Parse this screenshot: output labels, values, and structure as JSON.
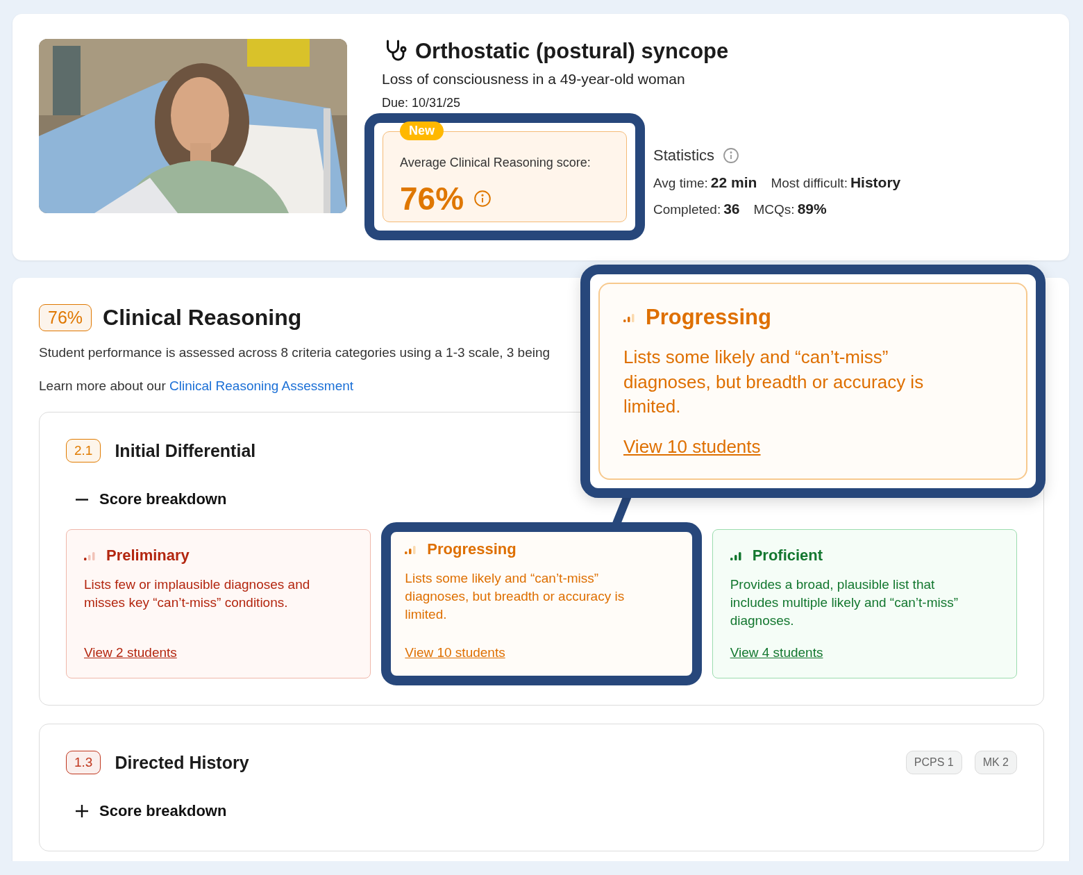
{
  "case": {
    "title": "Orthostatic (postural) syncope",
    "subtitle": "Loss of consciousness in a 49-year-old woman",
    "due": "Due: 10/31/25",
    "score_card": {
      "badge": "New",
      "label": "Average Clinical Reasoning score:",
      "value": "76%",
      "highlighted": true
    },
    "statistics": {
      "title": "Statistics",
      "items": [
        {
          "label": "Avg time:",
          "value": "22 min"
        },
        {
          "label": "Most difficult:",
          "value": "History"
        },
        {
          "label": "Completed:",
          "value": "36"
        },
        {
          "label": "MCQs:",
          "value": "89%"
        }
      ]
    }
  },
  "clinical_reasoning": {
    "score": "76%",
    "title": "Clinical Reasoning",
    "description": "Student performance is assessed across 8 criteria categories using a 1-3 scale, 3 being",
    "learn_more": "Learn more about our",
    "link": "Clinical Reasoning Assessment",
    "sections": [
      {
        "number": "2.1",
        "color": "#e07b00",
        "title": "Initial Differential",
        "expanded": true,
        "breakdown": "Score breakdown",
        "levels": [
          {
            "kind": "preliminary",
            "title": "Preliminary",
            "description": "Lists few or implausible diagnoses and misses key “can’t-miss” conditions.",
            "link": "View 2 students",
            "highlighted": false
          },
          {
            "kind": "progressing",
            "title": "Progressing",
            "description": "Lists some likely and “can’t-miss” diagnoses, but breadth or accuracy is limited.",
            "link": "View 10 students",
            "highlighted": true
          },
          {
            "kind": "proficient",
            "title": "Proficient",
            "description": "Provides a broad, plausible list that includes multiple likely and “can’t-miss” diagnoses.",
            "link": "View 4 students",
            "highlighted": false
          }
        ]
      },
      {
        "number": "1.3",
        "color": "#c0381f",
        "title": "Directed History",
        "expanded": false,
        "breakdown": "Score breakdown",
        "tags": [
          "PCPS 1",
          "MK 2"
        ]
      }
    ]
  },
  "callout": {
    "kind": "progressing",
    "title": "Progressing",
    "description": "Lists some likely and “can’t-miss” diagnoses, but breadth or accuracy is limited.",
    "link": "View 10 students"
  }
}
